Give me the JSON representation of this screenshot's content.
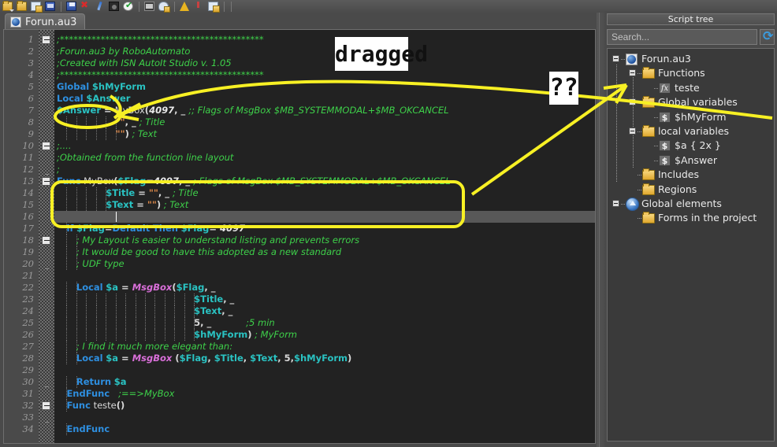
{
  "window": {
    "tab_title": "Forun.au3",
    "tab_icon": "autoit-script-icon"
  },
  "toolbar": {
    "icons": [
      {
        "name": "open-folder-icon",
        "glyph": "g-folder",
        "dropdown": true
      },
      {
        "name": "save-all-icon",
        "glyph": "g-folder",
        "dropdown": false
      },
      {
        "name": "build-flag-icon",
        "glyph": "g-doc",
        "dropdown": false
      },
      {
        "name": "new-form-icon",
        "glyph": "g-blue",
        "dropdown": false
      },
      {
        "name": "save-form-icon",
        "glyph": "g-save",
        "dropdown": false
      },
      {
        "name": "delete-icon",
        "glyph": "g-red",
        "dropdown": false
      },
      {
        "name": "edit-pen-icon",
        "glyph": "g-pen",
        "dropdown": false
      },
      {
        "name": "settings-dark-icon",
        "glyph": "g-dark",
        "dropdown": false
      },
      {
        "name": "run-check-icon",
        "glyph": "g-green",
        "dropdown": false
      },
      {
        "name": "console-icon",
        "glyph": "g-mail",
        "dropdown": false
      },
      {
        "name": "cloud-upload-icon",
        "glyph": "g-cloud",
        "dropdown": false
      },
      {
        "name": "warning-icon",
        "glyph": "g-warn",
        "dropdown": false
      },
      {
        "name": "small-red-icon",
        "glyph": "g-warn2",
        "dropdown": false
      },
      {
        "name": "document-icon",
        "glyph": "g-doc",
        "dropdown": false
      }
    ]
  },
  "editor": {
    "current_line": 16,
    "first_line_number": 1,
    "last_line_number": 34,
    "lines": [
      {
        "n": 1,
        "fold": "box",
        "tokens": [
          {
            "t": ";*********************************************",
            "c": "t-cm"
          }
        ]
      },
      {
        "n": 2,
        "fold": "",
        "tokens": [
          {
            "t": ";Forun.au3 by RoboAutomato",
            "c": "t-cm"
          }
        ]
      },
      {
        "n": 3,
        "fold": "",
        "tokens": [
          {
            "t": ";Created with ISN AutoIt Studio v. 1.05",
            "c": "t-cm"
          }
        ]
      },
      {
        "n": 4,
        "fold": "tick",
        "tokens": [
          {
            "t": ";*********************************************",
            "c": "t-cm"
          }
        ]
      },
      {
        "n": 5,
        "fold": "",
        "tokens": [
          {
            "t": "Global",
            "c": "t-kw"
          },
          {
            "t": " ",
            "c": "t-pl"
          },
          {
            "t": "$hMyForm",
            "c": "t-var"
          }
        ]
      },
      {
        "n": 6,
        "fold": "",
        "tokens": [
          {
            "t": "Local",
            "c": "t-kw"
          },
          {
            "t": " ",
            "c": "t-pl"
          },
          {
            "t": "$Answer",
            "c": "t-var"
          }
        ]
      },
      {
        "n": 7,
        "fold": "",
        "tokens": [
          {
            "t": "$Answer",
            "c": "t-var"
          },
          {
            "t": " = ",
            "c": "t-op"
          },
          {
            "t": "MyBox",
            "c": "t-pl"
          },
          {
            "t": "(",
            "c": "t-op"
          },
          {
            "t": "4097",
            "c": "t-num"
          },
          {
            "t": ", _ ",
            "c": "t-op"
          },
          {
            "t": ";; Flags of MsgBox $MB_SYSTEMMODAL+$MB_OKCANCEL",
            "c": "t-cm"
          }
        ]
      },
      {
        "n": 8,
        "fold": "",
        "indent": 6,
        "tokens": [
          {
            "t": "\"\"",
            "c": "t-str"
          },
          {
            "t": ", _ ",
            "c": "t-op"
          },
          {
            "t": "; Title",
            "c": "t-cm"
          }
        ]
      },
      {
        "n": 9,
        "fold": "",
        "indent": 6,
        "tokens": [
          {
            "t": "\"\"",
            "c": "t-str"
          },
          {
            "t": ")",
            "c": "t-op"
          },
          {
            "t": " ; Text",
            "c": "t-cm"
          }
        ]
      },
      {
        "n": 10,
        "fold": "box",
        "tokens": [
          {
            "t": ";....",
            "c": "t-cm"
          }
        ]
      },
      {
        "n": 11,
        "fold": "",
        "tokens": [
          {
            "t": ";Obtained from the function line layout",
            "c": "t-cm"
          }
        ]
      },
      {
        "n": 12,
        "fold": "tick",
        "tokens": [
          {
            "t": ";",
            "c": "t-cm"
          }
        ]
      },
      {
        "n": 13,
        "fold": "box",
        "tokens": [
          {
            "t": "Func",
            "c": "t-kw"
          },
          {
            "t": " MyBox",
            "c": "t-pl"
          },
          {
            "t": "(",
            "c": "t-op"
          },
          {
            "t": "$Flag",
            "c": "t-var"
          },
          {
            "t": "=",
            "c": "t-op"
          },
          {
            "t": "4097",
            "c": "t-num"
          },
          {
            "t": ", _ ",
            "c": "t-op"
          },
          {
            "t": "; Flags of MsgBox $MB_SYSTEMMODAL+$MB_OKCANCEL",
            "c": "t-cm"
          }
        ]
      },
      {
        "n": 14,
        "fold": "",
        "indent": 5,
        "tokens": [
          {
            "t": "$Title",
            "c": "t-var"
          },
          {
            "t": " = ",
            "c": "t-op"
          },
          {
            "t": "\"\"",
            "c": "t-str"
          },
          {
            "t": ", _ ",
            "c": "t-op"
          },
          {
            "t": "; Title",
            "c": "t-cm"
          }
        ]
      },
      {
        "n": 15,
        "fold": "",
        "indent": 5,
        "tokens": [
          {
            "t": "$Text",
            "c": "t-var"
          },
          {
            "t": " = ",
            "c": "t-op"
          },
          {
            "t": "\"\"",
            "c": "t-str"
          },
          {
            "t": ")",
            "c": "t-op"
          },
          {
            "t": " ; Text",
            "c": "t-cm"
          }
        ]
      },
      {
        "n": 16,
        "fold": "",
        "tokens": []
      },
      {
        "n": 17,
        "fold": "",
        "indent": 1,
        "tokens": [
          {
            "t": "if",
            "c": "t-kw"
          },
          {
            "t": " ",
            "c": "t-pl"
          },
          {
            "t": "$Flag",
            "c": "t-var"
          },
          {
            "t": "=",
            "c": "t-op"
          },
          {
            "t": "Default",
            "c": "t-kw"
          },
          {
            "t": " ",
            "c": "t-pl"
          },
          {
            "t": "Then",
            "c": "t-kw"
          },
          {
            "t": " ",
            "c": "t-pl"
          },
          {
            "t": "$Flag",
            "c": "t-var"
          },
          {
            "t": "= ",
            "c": "t-op"
          },
          {
            "t": "4097",
            "c": "t-num"
          }
        ]
      },
      {
        "n": 18,
        "fold": "box",
        "indent": 2,
        "tokens": [
          {
            "t": "; My Layout is easier to understand listing and prevents errors",
            "c": "t-cm"
          }
        ]
      },
      {
        "n": 19,
        "fold": "",
        "indent": 2,
        "tokens": [
          {
            "t": "; It would be good to have this adopted as a new standard",
            "c": "t-cm"
          }
        ]
      },
      {
        "n": 20,
        "fold": "tick",
        "indent": 2,
        "tokens": [
          {
            "t": "; UDF type",
            "c": "t-cm"
          }
        ]
      },
      {
        "n": 21,
        "fold": "",
        "tokens": []
      },
      {
        "n": 22,
        "fold": "",
        "indent": 2,
        "tokens": [
          {
            "t": "Local",
            "c": "t-kw"
          },
          {
            "t": " ",
            "c": "t-pl"
          },
          {
            "t": "$a",
            "c": "t-var"
          },
          {
            "t": " = ",
            "c": "t-op"
          },
          {
            "t": "MsgBox",
            "c": "t-fn"
          },
          {
            "t": "(",
            "c": "t-op"
          },
          {
            "t": "$Flag",
            "c": "t-var"
          },
          {
            "t": ", _",
            "c": "t-op"
          }
        ]
      },
      {
        "n": 23,
        "fold": "",
        "indent": 14,
        "tokens": [
          {
            "t": "$Title",
            "c": "t-var"
          },
          {
            "t": ", _",
            "c": "t-op"
          }
        ]
      },
      {
        "n": 24,
        "fold": "",
        "indent": 14,
        "tokens": [
          {
            "t": "$Text",
            "c": "t-var"
          },
          {
            "t": ", _",
            "c": "t-op"
          }
        ]
      },
      {
        "n": 25,
        "fold": "",
        "indent": 14,
        "tokens": [
          {
            "t": "5, _",
            "c": "t-op"
          },
          {
            "t": "            ",
            "c": "t-pl"
          },
          {
            "t": ";5 min",
            "c": "t-cm"
          }
        ]
      },
      {
        "n": 26,
        "fold": "",
        "indent": 14,
        "tokens": [
          {
            "t": "$hMyForm",
            "c": "t-var"
          },
          {
            "t": ")",
            "c": "t-op"
          },
          {
            "t": " ; MyForm",
            "c": "t-cm"
          }
        ]
      },
      {
        "n": 27,
        "fold": "",
        "indent": 2,
        "tokens": [
          {
            "t": "; I find it much more elegant than:",
            "c": "t-cm"
          }
        ]
      },
      {
        "n": 28,
        "fold": "",
        "indent": 2,
        "tokens": [
          {
            "t": "Local",
            "c": "t-kw"
          },
          {
            "t": " ",
            "c": "t-pl"
          },
          {
            "t": "$a",
            "c": "t-var"
          },
          {
            "t": " = ",
            "c": "t-op"
          },
          {
            "t": "MsgBox",
            "c": "t-fn"
          },
          {
            "t": " (",
            "c": "t-op"
          },
          {
            "t": "$Flag",
            "c": "t-var"
          },
          {
            "t": ", ",
            "c": "t-op"
          },
          {
            "t": "$Title",
            "c": "t-var"
          },
          {
            "t": ", ",
            "c": "t-op"
          },
          {
            "t": "$Text",
            "c": "t-var"
          },
          {
            "t": ", 5,",
            "c": "t-op"
          },
          {
            "t": "$hMyForm",
            "c": "t-var"
          },
          {
            "t": ")",
            "c": "t-op"
          }
        ]
      },
      {
        "n": 29,
        "fold": "",
        "tokens": []
      },
      {
        "n": 30,
        "fold": "tick",
        "indent": 2,
        "tokens": [
          {
            "t": "Return",
            "c": "t-kw"
          },
          {
            "t": " ",
            "c": "t-pl"
          },
          {
            "t": "$a",
            "c": "t-var"
          }
        ]
      },
      {
        "n": 31,
        "fold": "",
        "indent": 1,
        "tokens": [
          {
            "t": "EndFunc",
            "c": "t-kw"
          },
          {
            "t": "   ",
            "c": "t-pl"
          },
          {
            "t": ";==>MyBox",
            "c": "t-cm"
          }
        ]
      },
      {
        "n": 32,
        "fold": "box",
        "indent": 1,
        "tokens": [
          {
            "t": "Func",
            "c": "t-kw"
          },
          {
            "t": " teste",
            "c": "t-pl"
          },
          {
            "t": "()",
            "c": "t-op"
          }
        ]
      },
      {
        "n": 33,
        "fold": "tick",
        "tokens": []
      },
      {
        "n": 34,
        "fold": "",
        "indent": 1,
        "tokens": [
          {
            "t": "EndFunc",
            "c": "t-kw"
          }
        ]
      }
    ]
  },
  "script_tree": {
    "title": "Script tree",
    "search": {
      "placeholder": "Search...",
      "value": ""
    },
    "refresh_button_name": "refresh-tree-button",
    "nodes": [
      {
        "label": "Forun.au3",
        "icon": "script-file-icon",
        "depth": 0,
        "expander": true
      },
      {
        "label": "Functions",
        "icon": "folder-icon",
        "depth": 1,
        "expander": true
      },
      {
        "label": "teste",
        "icon": "function-icon",
        "depth": 2,
        "expander": false
      },
      {
        "label": "Global variables",
        "icon": "folder-icon",
        "depth": 1,
        "expander": true
      },
      {
        "label": "$hMyForm",
        "icon": "variable-icon",
        "depth": 2,
        "expander": false
      },
      {
        "label": "local variables",
        "icon": "folder-icon",
        "depth": 1,
        "expander": true
      },
      {
        "label": "$a  { 2x }",
        "icon": "variable-icon",
        "depth": 2,
        "expander": false
      },
      {
        "label": "$Answer",
        "icon": "variable-icon",
        "depth": 2,
        "expander": false
      },
      {
        "label": "Includes",
        "icon": "folder-icon",
        "depth": 1,
        "expander": false
      },
      {
        "label": "Regions",
        "icon": "folder-icon",
        "depth": 1,
        "expander": false
      },
      {
        "label": "Global elements",
        "icon": "globe-icon",
        "depth": 0,
        "expander": true
      },
      {
        "label": "Forms in the project",
        "icon": "folder-icon",
        "depth": 1,
        "expander": false
      }
    ]
  },
  "annotations": {
    "accent_color": "#f7f024",
    "labels": [
      {
        "name": "dragged-label",
        "text": "dragged"
      },
      {
        "name": "question-label",
        "text": "??"
      }
    ],
    "marks": [
      {
        "name": "ellipse-around-answer-variable",
        "shape": "ellipse"
      },
      {
        "name": "rounded-rect-around-func-signature",
        "shape": "rounded-rect"
      },
      {
        "name": "curve-from-answer-to-tree",
        "shape": "curve-arrow"
      },
      {
        "name": "arrow-from-func-box-to-tree",
        "shape": "arrow"
      }
    ]
  }
}
